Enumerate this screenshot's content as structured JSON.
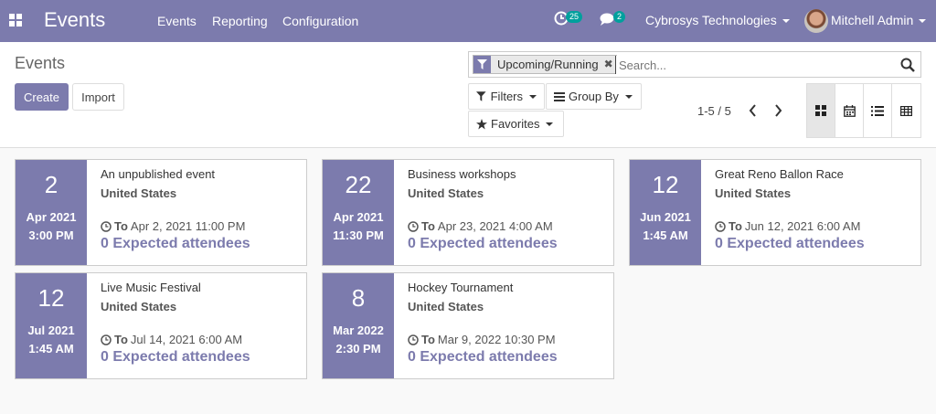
{
  "navbar": {
    "app_title": "Events",
    "menu": [
      "Events",
      "Reporting",
      "Configuration"
    ],
    "activity_count": "25",
    "messages_count": "2",
    "company": "Cybrosys Technologies",
    "user": "Mitchell Admin",
    "bg_color": "#7c7bad"
  },
  "control_panel": {
    "breadcrumb": "Events",
    "create_label": "Create",
    "import_label": "Import",
    "search": {
      "facet_label": "Upcoming/Running",
      "placeholder": "Search..."
    },
    "filters_label": "Filters",
    "groupby_label": "Group By",
    "favorites_label": "Favorites",
    "pager": "1-5 / 5",
    "views": [
      "kanban-icon",
      "calendar-icon",
      "list-icon",
      "pivot-icon"
    ],
    "active_view": "kanban"
  },
  "events": [
    {
      "day": "2",
      "month": "Apr 2021",
      "time": "3:00 PM",
      "name": "An unpublished event",
      "location": "United States",
      "to_label": "To",
      "to_date": "Apr 2, 2021 11:00 PM",
      "attendees": "0 Expected attendees"
    },
    {
      "day": "22",
      "month": "Apr 2021",
      "time": "11:30 PM",
      "name": "Business workshops",
      "location": "United States",
      "to_label": "To",
      "to_date": "Apr 23, 2021 4:00 AM",
      "attendees": "0 Expected attendees"
    },
    {
      "day": "12",
      "month": "Jun 2021",
      "time": "1:45 AM",
      "name": "Great Reno Ballon Race",
      "location": "United States",
      "to_label": "To",
      "to_date": "Jun 12, 2021 6:00 AM",
      "attendees": "0 Expected attendees"
    },
    {
      "day": "12",
      "month": "Jul 2021",
      "time": "1:45 AM",
      "name": "Live Music Festival",
      "location": "United States",
      "to_label": "To",
      "to_date": "Jul 14, 2021 6:00 AM",
      "attendees": "0 Expected attendees"
    },
    {
      "day": "8",
      "month": "Mar 2022",
      "time": "2:30 PM",
      "name": "Hockey Tournament",
      "location": "United States",
      "to_label": "To",
      "to_date": "Mar 9, 2022 10:30 PM",
      "attendees": "0 Expected attendees"
    }
  ]
}
